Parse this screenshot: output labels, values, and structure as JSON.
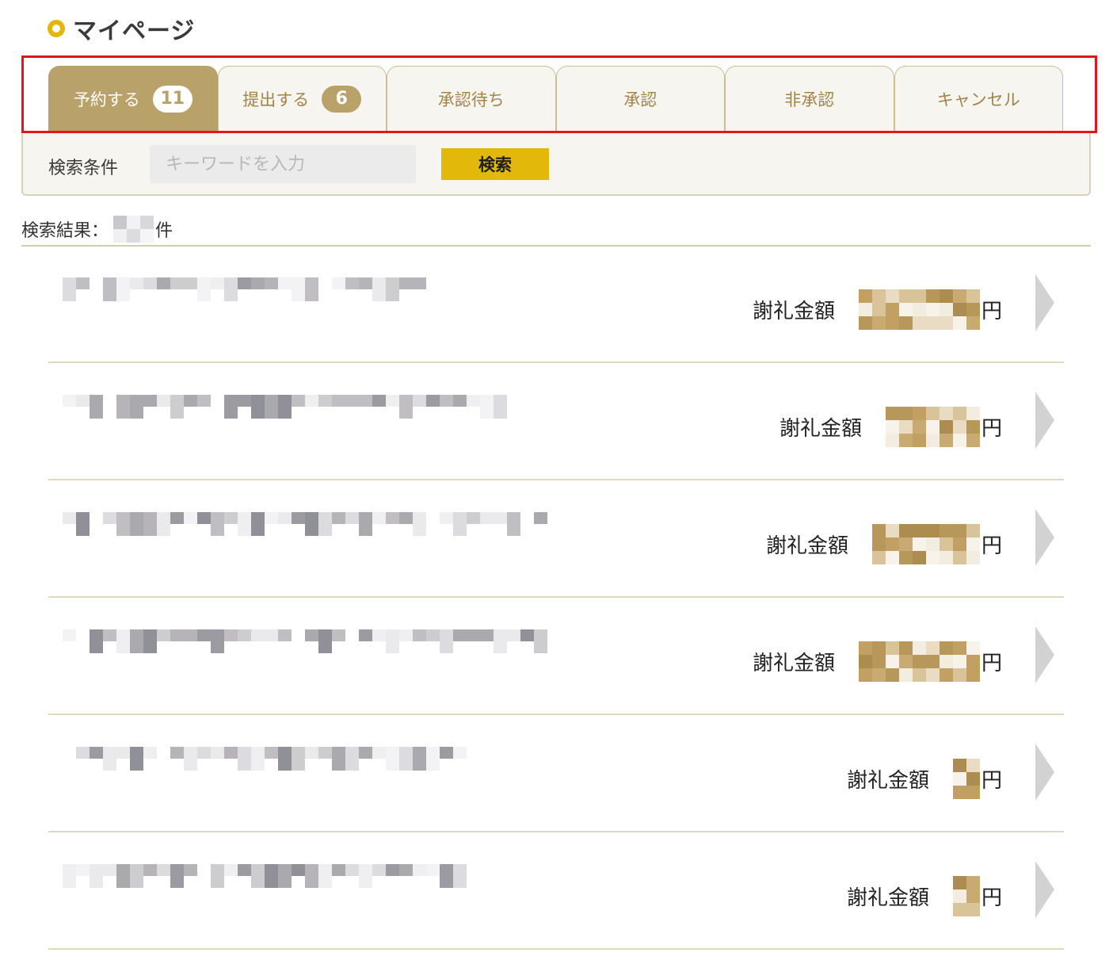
{
  "header": {
    "title": "マイページ"
  },
  "tabs": [
    {
      "label": "予約する",
      "badge": "11"
    },
    {
      "label": "提出する",
      "badge": "6"
    },
    {
      "label": "承認待ち"
    },
    {
      "label": "承認"
    },
    {
      "label": "非承認"
    },
    {
      "label": "キャンセル"
    }
  ],
  "search": {
    "label": "検索条件",
    "placeholder": "キーワードを入力",
    "button": "検索"
  },
  "results": {
    "prefix": "検索結果：",
    "suffix": "件",
    "rows": [
      {
        "fee_label": "謝礼金額",
        "fee_unit": "円"
      },
      {
        "fee_label": "謝礼金額",
        "fee_unit": "円"
      },
      {
        "fee_label": "謝礼金額",
        "fee_unit": "円"
      },
      {
        "fee_label": "謝礼金額",
        "fee_unit": "円"
      },
      {
        "fee_label": "謝礼金額",
        "fee_unit": "円"
      },
      {
        "fee_label": "謝礼金額",
        "fee_unit": "円"
      }
    ]
  },
  "colors": {
    "accent_gold": "#b9a26a",
    "search_button": "#e2b80a",
    "highlight_frame": "#e8141b",
    "panel_bg": "#f6f5f0"
  }
}
